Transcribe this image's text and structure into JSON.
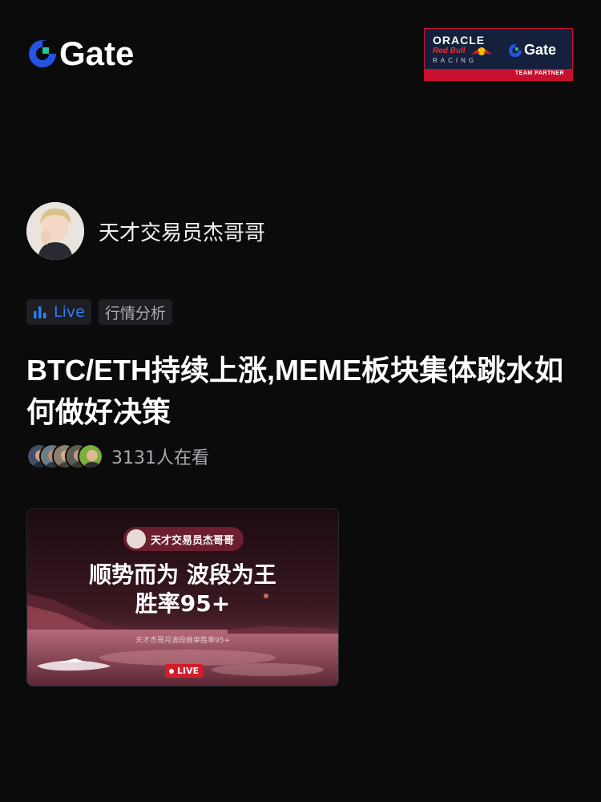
{
  "brand": {
    "name": "Gate",
    "icon": "gate-logo-icon",
    "color": "#2354e6"
  },
  "partner": {
    "oracle": "ORACLE",
    "redbull": "Red Bull",
    "racing": "RACING",
    "gate": "Gate",
    "tag": "TEAM PARTNER",
    "colors": {
      "navy": "#15203c",
      "red": "#c8102e"
    }
  },
  "host": {
    "name": "天才交易员杰哥哥",
    "avatar": "avatar"
  },
  "tags": {
    "live_label": "Live",
    "live_icon": "bar-chart-icon",
    "category": "行情分析",
    "accent": "#2f7df6"
  },
  "title": "BTC/ETH持续上涨,MEME板块集体跳水如何做好决策",
  "viewers": {
    "count_text": "3131人在看"
  },
  "cover": {
    "host_name": "天才交易员杰哥哥",
    "headline_1": "顺势而为 波段为王",
    "headline_2": "胜率95+",
    "subline": "天才杰哥月波段做单胜率95+",
    "live_badge": "LIVE"
  }
}
